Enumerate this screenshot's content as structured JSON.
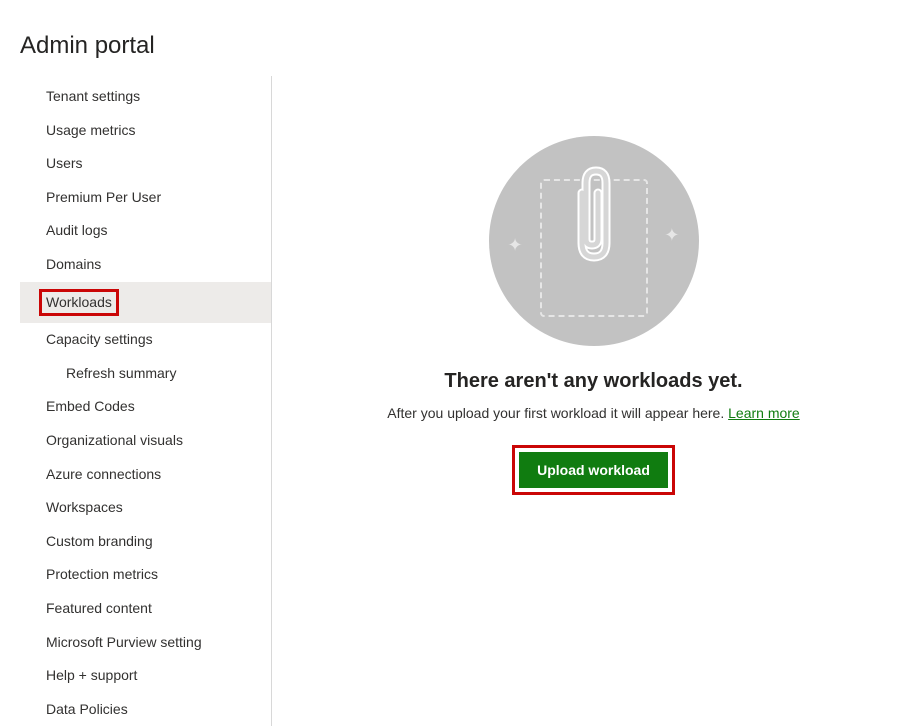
{
  "page": {
    "title": "Admin portal"
  },
  "sidebar": {
    "items": [
      {
        "label": "Tenant settings",
        "selected": false,
        "indented": false
      },
      {
        "label": "Usage metrics",
        "selected": false,
        "indented": false
      },
      {
        "label": "Users",
        "selected": false,
        "indented": false
      },
      {
        "label": "Premium Per User",
        "selected": false,
        "indented": false
      },
      {
        "label": "Audit logs",
        "selected": false,
        "indented": false
      },
      {
        "label": "Domains",
        "selected": false,
        "indented": false
      },
      {
        "label": "Workloads",
        "selected": true,
        "indented": false,
        "highlighted": true
      },
      {
        "label": "Capacity settings",
        "selected": false,
        "indented": false
      },
      {
        "label": "Refresh summary",
        "selected": false,
        "indented": true
      },
      {
        "label": "Embed Codes",
        "selected": false,
        "indented": false
      },
      {
        "label": "Organizational visuals",
        "selected": false,
        "indented": false
      },
      {
        "label": "Azure connections",
        "selected": false,
        "indented": false
      },
      {
        "label": "Workspaces",
        "selected": false,
        "indented": false
      },
      {
        "label": "Custom branding",
        "selected": false,
        "indented": false
      },
      {
        "label": "Protection metrics",
        "selected": false,
        "indented": false
      },
      {
        "label": "Featured content",
        "selected": false,
        "indented": false
      },
      {
        "label": "Microsoft Purview setting",
        "selected": false,
        "indented": false
      },
      {
        "label": "Help + support",
        "selected": false,
        "indented": false
      },
      {
        "label": "Data Policies",
        "selected": false,
        "indented": false
      }
    ]
  },
  "main": {
    "emptyTitle": "There aren't any workloads yet.",
    "emptySubtitle": "After you upload your first workload it will appear here. ",
    "learnMoreLabel": "Learn more",
    "uploadButtonLabel": "Upload workload"
  }
}
